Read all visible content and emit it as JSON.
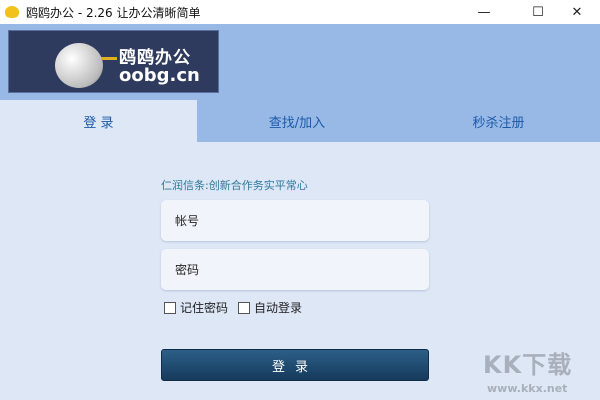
{
  "window": {
    "title": "鸥鸥办公 - 2.26 让办公清晰简单",
    "minimize": "—",
    "maximize": "☐",
    "close": "✕"
  },
  "logo": {
    "cn": "鸥鸥办公",
    "en": "oobg.cn"
  },
  "tabs": [
    {
      "label": "登 录",
      "active": true
    },
    {
      "label": "查找/加入"
    },
    {
      "label": "秒杀注册"
    }
  ],
  "motto": "仁润信条:创新合作务实平常心",
  "form": {
    "account_placeholder": "帐号",
    "password_placeholder": "密码",
    "remember": "记住密码",
    "auto_login": "自动登录",
    "login_button": "登录"
  },
  "watermark": {
    "text": "KK下载",
    "url": "www.kkx.net"
  }
}
